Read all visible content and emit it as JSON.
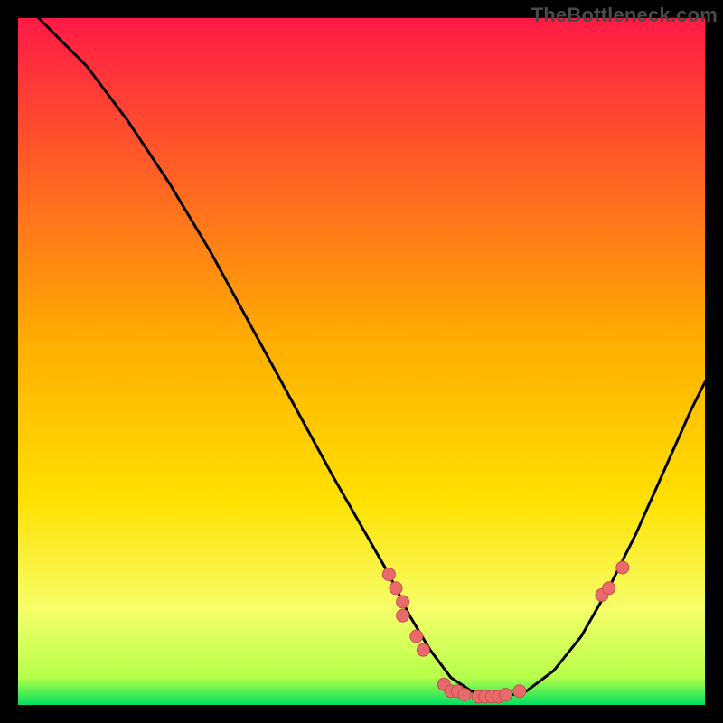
{
  "attribution": "TheBottleneck.com",
  "colors": {
    "bg_black": "#000000",
    "grad_top": "#ff1a46",
    "grad_mid": "#ffd100",
    "grad_low": "#f6ff6a",
    "grad_bottom": "#00e060",
    "curve": "#000000",
    "marker_fill": "#e86a6a",
    "marker_stroke": "#c94f4f"
  },
  "chart_data": {
    "type": "line",
    "title": "",
    "xlabel": "",
    "ylabel": "",
    "xlim": [
      0,
      100
    ],
    "ylim": [
      0,
      100
    ],
    "curve": [
      {
        "x": 3,
        "y": 100
      },
      {
        "x": 6,
        "y": 97
      },
      {
        "x": 10,
        "y": 93
      },
      {
        "x": 16,
        "y": 85
      },
      {
        "x": 22,
        "y": 76
      },
      {
        "x": 28,
        "y": 66
      },
      {
        "x": 34,
        "y": 55
      },
      {
        "x": 40,
        "y": 44
      },
      {
        "x": 46,
        "y": 33
      },
      {
        "x": 50,
        "y": 26
      },
      {
        "x": 54,
        "y": 19
      },
      {
        "x": 57,
        "y": 13
      },
      {
        "x": 60,
        "y": 8
      },
      {
        "x": 63,
        "y": 4
      },
      {
        "x": 66,
        "y": 2
      },
      {
        "x": 70,
        "y": 1
      },
      {
        "x": 74,
        "y": 2
      },
      {
        "x": 78,
        "y": 5
      },
      {
        "x": 82,
        "y": 10
      },
      {
        "x": 86,
        "y": 17
      },
      {
        "x": 90,
        "y": 25
      },
      {
        "x": 94,
        "y": 34
      },
      {
        "x": 98,
        "y": 43
      },
      {
        "x": 100,
        "y": 47
      }
    ],
    "markers": [
      {
        "x": 54,
        "y": 19
      },
      {
        "x": 55,
        "y": 17
      },
      {
        "x": 56,
        "y": 15
      },
      {
        "x": 56,
        "y": 13
      },
      {
        "x": 58,
        "y": 10
      },
      {
        "x": 59,
        "y": 8
      },
      {
        "x": 62,
        "y": 3
      },
      {
        "x": 63,
        "y": 2
      },
      {
        "x": 64,
        "y": 2
      },
      {
        "x": 65,
        "y": 1.5
      },
      {
        "x": 67,
        "y": 1.2
      },
      {
        "x": 68,
        "y": 1.2
      },
      {
        "x": 69,
        "y": 1.2
      },
      {
        "x": 70,
        "y": 1.2
      },
      {
        "x": 71,
        "y": 1.5
      },
      {
        "x": 73,
        "y": 2
      },
      {
        "x": 85,
        "y": 16
      },
      {
        "x": 86,
        "y": 17
      },
      {
        "x": 88,
        "y": 20
      }
    ]
  }
}
